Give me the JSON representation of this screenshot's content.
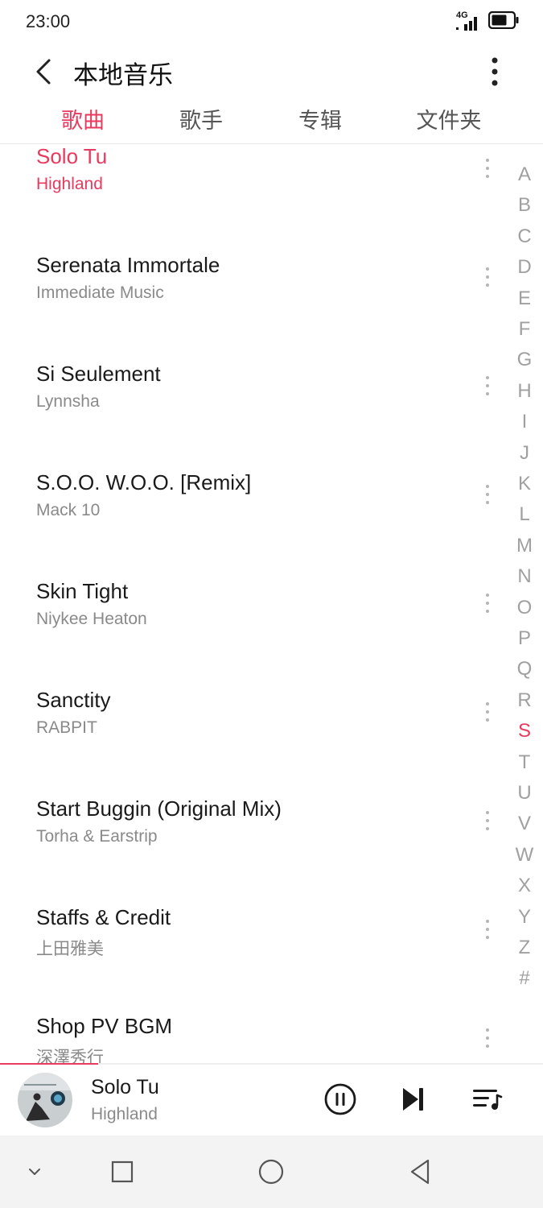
{
  "status_bar": {
    "time": "23:00",
    "network": "4G"
  },
  "header": {
    "title": "本地音乐"
  },
  "tabs": [
    {
      "label": "歌曲",
      "active": true
    },
    {
      "label": "歌手",
      "active": false
    },
    {
      "label": "专辑",
      "active": false
    },
    {
      "label": "文件夹",
      "active": false
    }
  ],
  "songs": [
    {
      "title": "Solo Tu",
      "artist": "Highland",
      "playing": true
    },
    {
      "title": "Serenata Immortale",
      "artist": "Immediate Music",
      "playing": false
    },
    {
      "title": "Si Seulement",
      "artist": "Lynnsha",
      "playing": false
    },
    {
      "title": "S.O.O. W.O.O. [Remix]",
      "artist": "Mack 10",
      "playing": false
    },
    {
      "title": "Skin Tight",
      "artist": "Niykee Heaton",
      "playing": false
    },
    {
      "title": "Sanctity",
      "artist": "RABPIT",
      "playing": false
    },
    {
      "title": "Start Buggin (Original Mix)",
      "artist": "Torha & Earstrip",
      "playing": false
    },
    {
      "title": "Staffs & Credit",
      "artist": "上田雅美",
      "playing": false
    },
    {
      "title": "Shop PV BGM",
      "artist": "深澤秀行",
      "playing": false
    }
  ],
  "alpha_index": {
    "letters": [
      "A",
      "B",
      "C",
      "D",
      "E",
      "F",
      "G",
      "H",
      "I",
      "J",
      "K",
      "L",
      "M",
      "N",
      "O",
      "P",
      "Q",
      "R",
      "S",
      "T",
      "U",
      "V",
      "W",
      "X",
      "Y",
      "Z",
      "#"
    ],
    "active": "S"
  },
  "now_playing": {
    "title": "Solo Tu",
    "artist": "Highland",
    "progress": 0.18
  },
  "colors": {
    "accent": "#e83a5e",
    "text_primary": "#1a1a1a",
    "text_secondary": "#8a8a8a",
    "nav_bg": "#f3f3f3"
  },
  "icons": {
    "back": "back-arrow-icon",
    "more": "more-vert-icon",
    "pause": "pause-icon",
    "next": "skip-next-icon",
    "playlist": "playlist-icon",
    "nav_down": "chevron-down-icon",
    "nav_recents": "square-icon",
    "nav_home": "circle-icon",
    "nav_back": "triangle-back-icon"
  }
}
